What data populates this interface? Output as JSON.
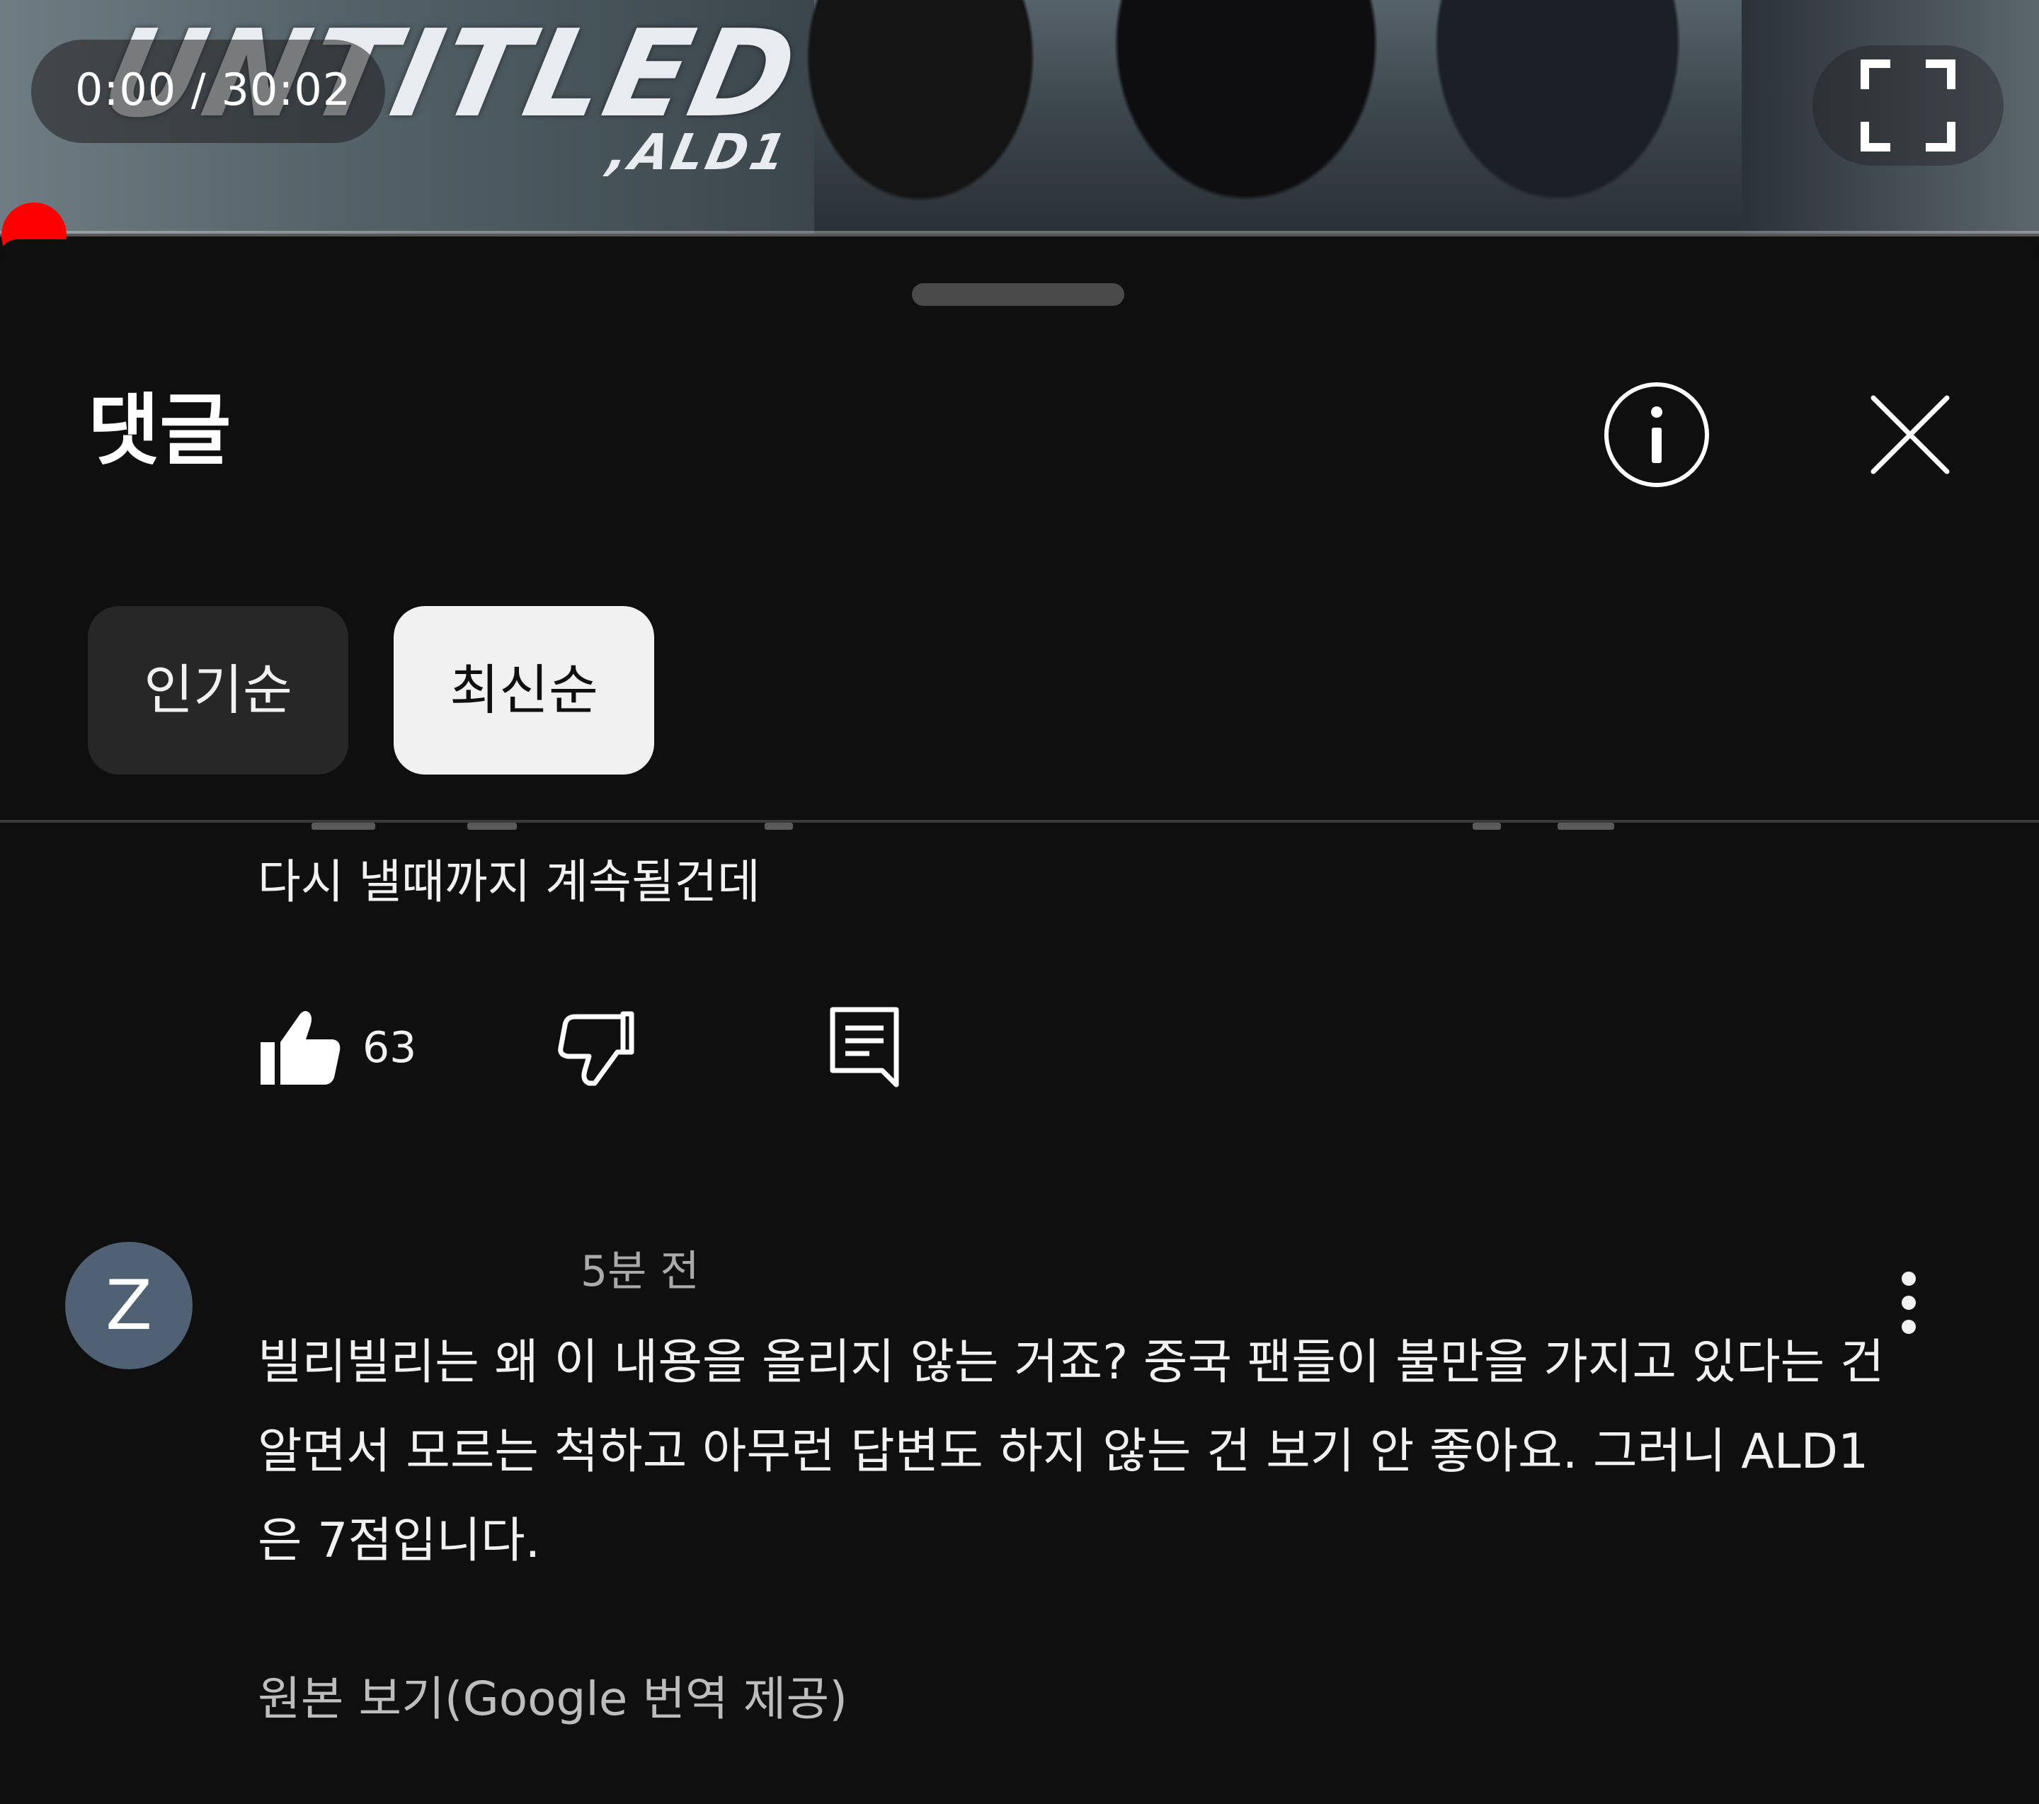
{
  "player": {
    "time_label": "0:00 / 30:02",
    "logo_main": "UNTITLED",
    "logo_sub": ",ALD1",
    "accent_color": "#ff0000"
  },
  "sheet": {
    "title": "댓글",
    "sort_chips": [
      {
        "label": "인기순",
        "selected": false
      },
      {
        "label": "최신순",
        "selected": true
      }
    ]
  },
  "comments": [
    {
      "text": "다시 낼때까지 계속될건데",
      "likes": "63"
    },
    {
      "avatar_letter": "Z",
      "time": "5분 전",
      "text": "빌리빌리는 왜 이 내용을 올리지 않는 거죠? 중국 팬들이 불만을 가지고 있다는 건 알면서 모르는 척하고 아무런 답변도 하지 않는 건 보기 안 좋아요. 그러니 ALD1은 7점입니다.",
      "translation_link": "원본 보기(Google 번역 제공)"
    }
  ],
  "icons": {
    "fullscreen": "fullscreen-icon",
    "info": "info-icon",
    "close": "close-icon",
    "like": "thumbs-up-icon",
    "dislike": "thumbs-down-icon",
    "reply": "reply-icon",
    "more": "more-vert-icon"
  }
}
